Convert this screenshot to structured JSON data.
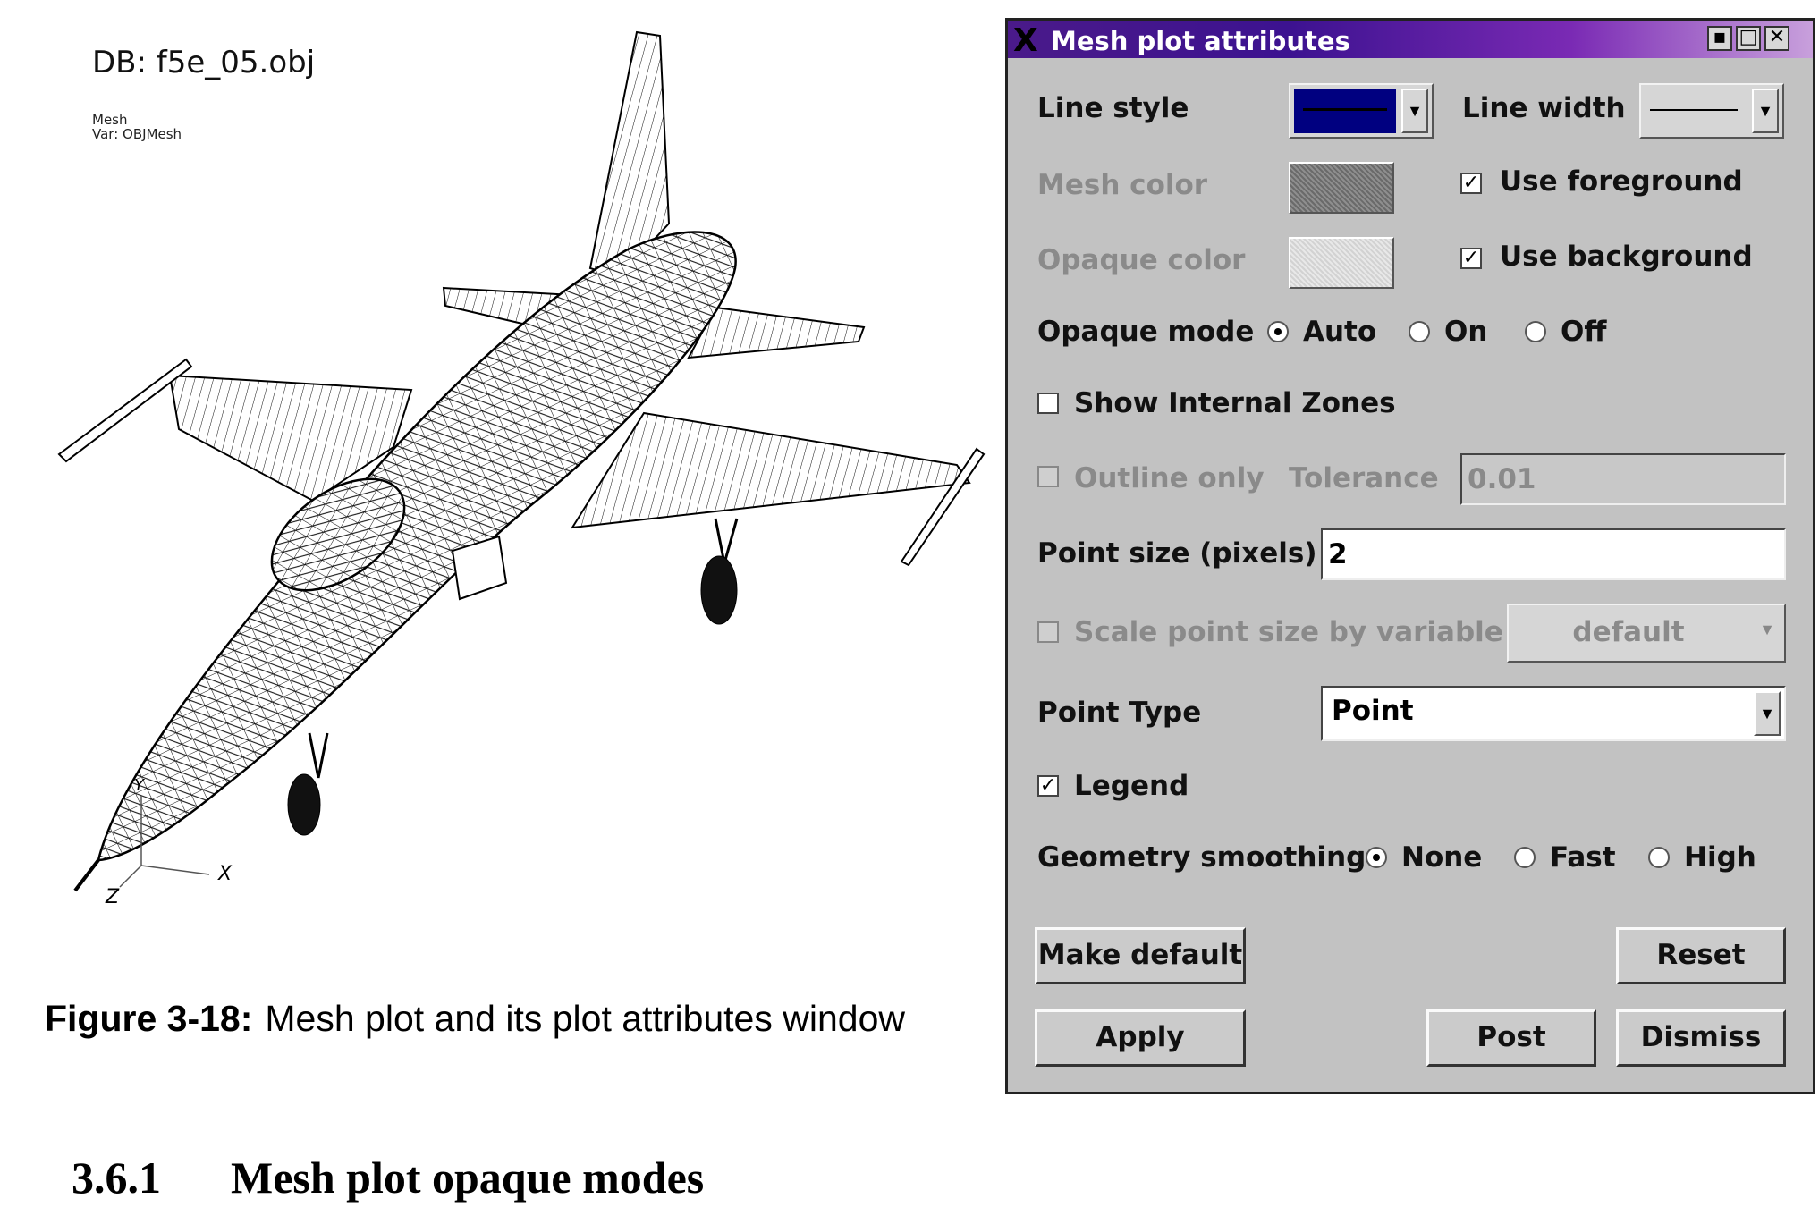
{
  "figure": {
    "db_label": "DB: f5e_05.obj",
    "plot_type": "Mesh",
    "plot_var": "Var: OBJMesh",
    "axis_x": "X",
    "axis_y": "Y",
    "axis_z": "Z",
    "caption_label": "Figure 3-18:",
    "caption_text": "Mesh plot and its plot attributes window"
  },
  "section": {
    "number": "3.6.1",
    "title": "Mesh plot opaque modes"
  },
  "window": {
    "title": "Mesh plot attributes",
    "title_icon": "X",
    "controls": {
      "iconify": "▪",
      "maximize": "□",
      "close": "✕"
    },
    "line_style_label": "Line style",
    "line_style_color": "#000080",
    "line_width_label": "Line width",
    "mesh_color_label": "Mesh color",
    "use_foreground_label": "Use foreground",
    "use_foreground_checked": true,
    "opaque_color_label": "Opaque color",
    "use_background_label": "Use background",
    "use_background_checked": true,
    "opaque_mode_label": "Opaque mode",
    "opaque_modes": [
      "Auto",
      "On",
      "Off"
    ],
    "opaque_mode_selected": "Auto",
    "show_internal_zones_label": "Show Internal Zones",
    "show_internal_zones_checked": false,
    "outline_only_label": "Outline only",
    "tolerance_label": "Tolerance",
    "tolerance_value": "0.01",
    "point_size_label": "Point size (pixels)",
    "point_size_value": "2",
    "scale_point_size_label": "Scale point size by variable",
    "scale_variable_value": "default",
    "point_type_label": "Point Type",
    "point_type_value": "Point",
    "legend_label": "Legend",
    "legend_checked": true,
    "geometry_smoothing_label": "Geometry smoothing",
    "smoothing_options": [
      "None",
      "Fast",
      "High"
    ],
    "smoothing_selected": "None",
    "check_mark": "✓",
    "dropdown_arrow": "▼",
    "buttons": {
      "make_default": "Make default",
      "reset": "Reset",
      "apply": "Apply",
      "post": "Post",
      "dismiss": "Dismiss"
    }
  },
  "colors": {
    "dialog_bg": "#c2c2c2",
    "title_gradient_start": "#3c1290",
    "title_gradient_end": "#c8a0dc",
    "line_style_swatch": "#000080"
  }
}
